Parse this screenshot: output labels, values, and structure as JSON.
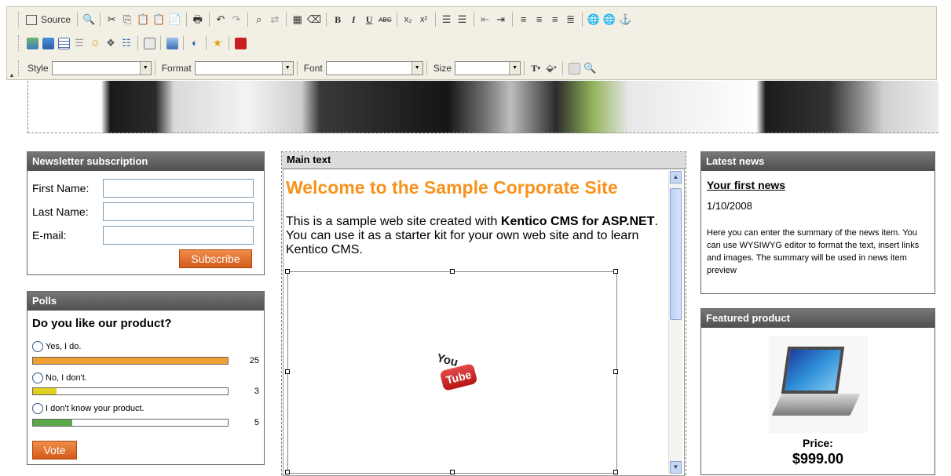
{
  "toolbar": {
    "source_label": "Source",
    "style_label": "Style",
    "format_label": "Format",
    "font_label": "Font",
    "size_label": "Size",
    "style_value": "",
    "format_value": "",
    "font_value": "",
    "size_value": "",
    "icons_row1": [
      "preview-icon",
      "cut-icon",
      "copy-icon",
      "paste-icon",
      "paste-text-icon",
      "paste-word-icon",
      "print-icon",
      "undo-icon",
      "redo-icon",
      "find-icon",
      "replace-icon",
      "select-all-icon",
      "remove-format-icon",
      "bold-icon",
      "italic-icon",
      "underline-icon",
      "strike-icon",
      "subscript-icon",
      "superscript-icon",
      "numbered-list-icon",
      "bulleted-list-icon",
      "outdent-icon",
      "indent-icon",
      "align-left-icon",
      "align-center-icon",
      "align-right-icon",
      "justify-icon",
      "link-icon",
      "unlink-icon",
      "anchor-icon"
    ],
    "icons_row2": [
      "image-icon",
      "flash-icon",
      "table-icon",
      "horizontal-rule-icon",
      "smiley-icon",
      "special-char-icon",
      "page-break-icon",
      "form-icon",
      "widget-icon",
      "web-part-icon",
      "poll-icon",
      "youtube-icon"
    ]
  },
  "newsletter": {
    "title": "Newsletter subscription",
    "first_name_label": "First Name:",
    "last_name_label": "Last Name:",
    "email_label": "E-mail:",
    "subscribe_label": "Subscribe"
  },
  "polls": {
    "title": "Polls",
    "question": "Do you like our product?",
    "options": [
      {
        "label": "Yes, I do.",
        "count": "25",
        "fraction": 1.0,
        "color": "#f0a030"
      },
      {
        "label": "No, I don't.",
        "count": "3",
        "fraction": 0.12,
        "color": "#e0d020"
      },
      {
        "label": "I don't know your product.",
        "count": "5",
        "fraction": 0.2,
        "color": "#5aa848"
      }
    ],
    "vote_label": "Vote"
  },
  "main": {
    "title": "Main text",
    "heading": "Welcome to the Sample Corporate Site",
    "intro_pre": "This is a sample web site created with ",
    "intro_bold": "Kentico CMS for ASP.NET",
    "intro_post": ". You can use it as a starter kit for your own web site and to learn Kentico CMS.",
    "youtube_you": "You",
    "youtube_tube": "Tube"
  },
  "news": {
    "title": "Latest news",
    "item_title": "Your first news",
    "item_date": "1/10/2008",
    "item_summary": "Here you can enter the summary of the news item. You can use WYSIWYG editor to format the text, insert links and images. The summary will be used in news item preview"
  },
  "featured": {
    "title": "Featured product",
    "price_label": "Price:",
    "price": "$999.00"
  }
}
